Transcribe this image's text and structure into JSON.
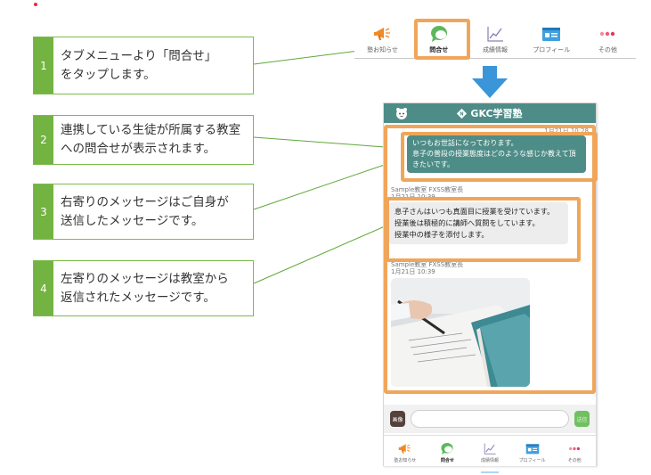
{
  "steps": [
    {
      "num": "1",
      "text": "タブメニューより「問合せ」\nをタップします。"
    },
    {
      "num": "2",
      "text": "連携している生徒が所属する教室\nへの問合せが表示されます。"
    },
    {
      "num": "3",
      "text": "右寄りのメッセージはご自身が\n送信したメッセージです。"
    },
    {
      "num": "4",
      "text": "左寄りのメッセージは教室から\n返信されたメッセージです。"
    }
  ],
  "tabs": [
    {
      "label": "塾お知らせ",
      "icon": "megaphone-icon"
    },
    {
      "label": "問合せ",
      "icon": "chat-bubble-icon",
      "selected": true
    },
    {
      "label": "成績情報",
      "icon": "line-chart-icon"
    },
    {
      "label": "プロフィール",
      "icon": "profile-card-icon"
    },
    {
      "label": "その他",
      "icon": "more-dots-icon"
    }
  ],
  "app": {
    "brand": "GKC学習塾"
  },
  "chat": {
    "sent_time": "1月21日 10:28",
    "sent_message": "いつもお世話になっております。\n息子の普段の授業態度はどのような感じか教えて頂きたいです。",
    "reply_sender": "Sample教室 FXSS教室長",
    "reply_time": "1月21日 10:39",
    "reply_message": "息子さんはいつも真面目に授業を受けています。\n授業後は積極的に講師へ質問をしています。\n授業中の様子を添付します。",
    "photo_sender": "Sample教室 FXSS教室長",
    "photo_time": "1月21日 10:39"
  },
  "input": {
    "image_button": "画像",
    "send_button": "送信"
  },
  "colors": {
    "accent_green": "#73b341",
    "highlight_orange": "#f0a65a",
    "header_teal": "#4e8c87",
    "arrow_blue": "#3b95d9"
  }
}
